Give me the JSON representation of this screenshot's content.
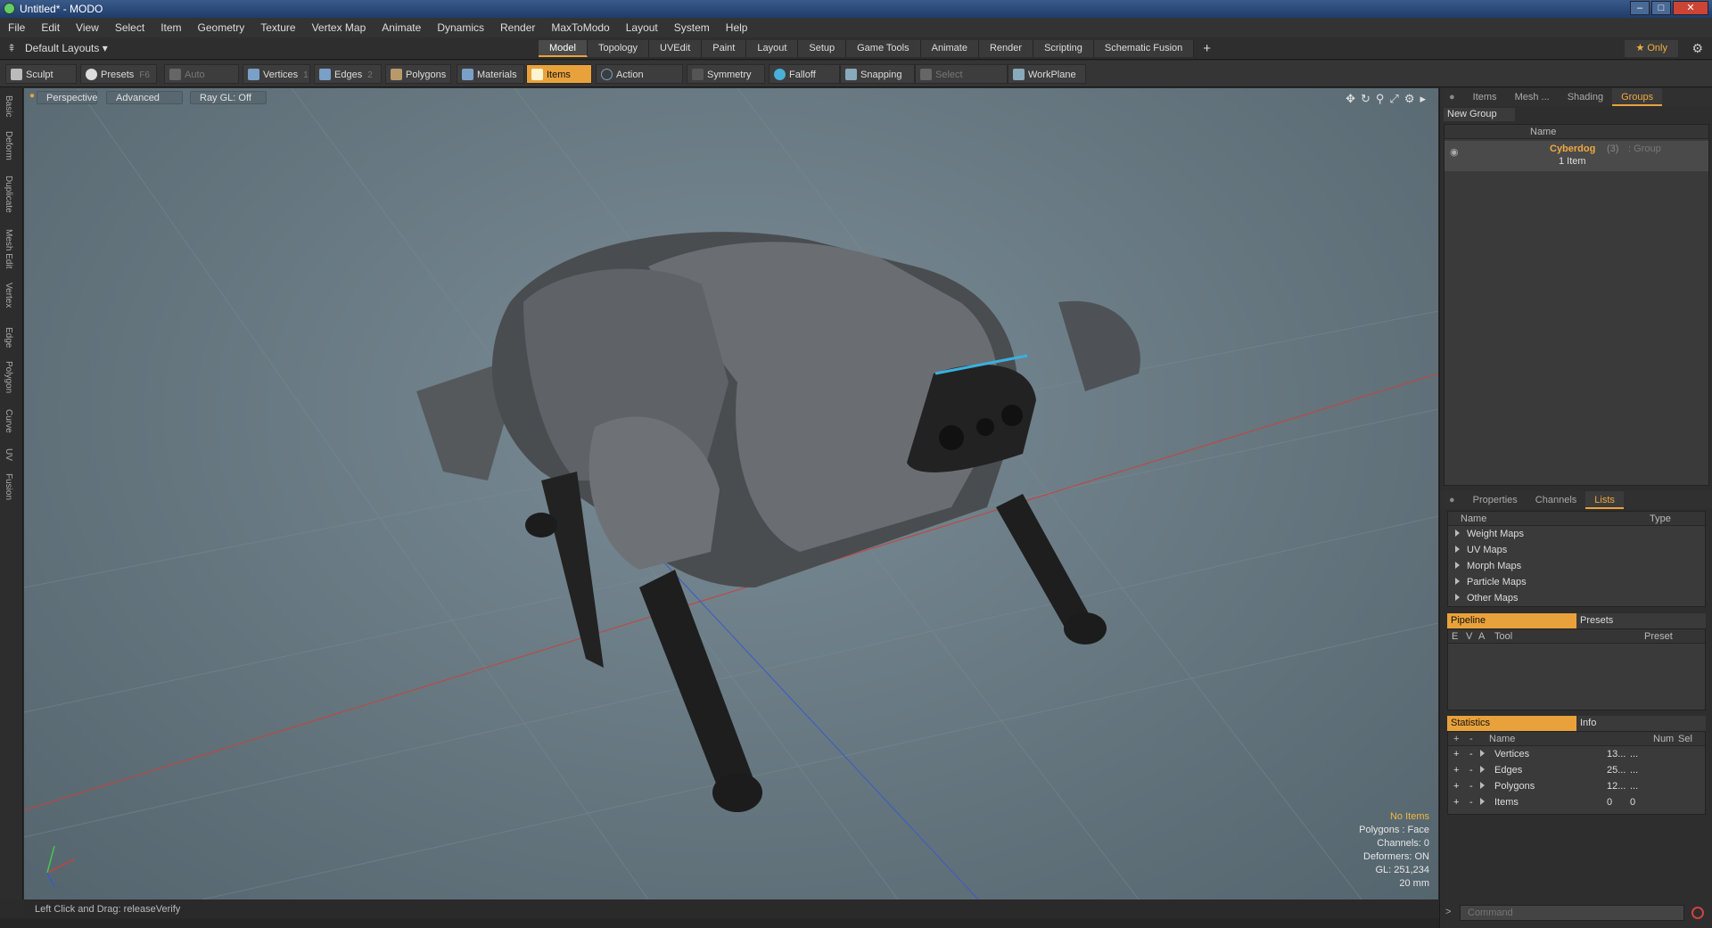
{
  "window": {
    "title": "Untitled* - MODO"
  },
  "menu": [
    "File",
    "Edit",
    "View",
    "Select",
    "Item",
    "Geometry",
    "Texture",
    "Vertex Map",
    "Animate",
    "Dynamics",
    "Render",
    "MaxToModo",
    "Layout",
    "System",
    "Help"
  ],
  "layout": {
    "menu_label": "Default Layouts ▾",
    "tabs": [
      "Model",
      "Topology",
      "UVEdit",
      "Paint",
      "Layout",
      "Setup",
      "Game Tools",
      "Animate",
      "Render",
      "Scripting",
      "Schematic Fusion"
    ],
    "active_tab": "Model",
    "add_tab": "+",
    "only_label": "★ Only"
  },
  "toolbar": {
    "sculpt": "Sculpt",
    "presets": "Presets",
    "presets_key": "F6",
    "auto_select": "Auto Select",
    "vertices": "Vertices",
    "vertices_key": "1",
    "edges": "Edges",
    "edges_key": "2",
    "polygons": "Polygons",
    "materials": "Materials",
    "items": "Items",
    "action_center": "Action Center",
    "symmetry": "Symmetry",
    "falloff": "Falloff",
    "snapping": "Snapping",
    "select_through": "Select Through",
    "workplane": "WorkPlane"
  },
  "left_strip": [
    "Basic",
    "Deform",
    "Duplicate",
    "Mesh Edit",
    "Vertex",
    "Edge",
    "Polygon",
    "Curve",
    "UV",
    "Fusion"
  ],
  "viewport": {
    "perspective": "Perspective",
    "advanced": "Advanced",
    "raygl": "Ray GL: Off",
    "stats": {
      "no_items": "No Items",
      "polygons": "Polygons : Face",
      "channels": "Channels: 0",
      "deformers": "Deformers: ON",
      "gl": "GL: 251,234",
      "scale": "20 mm"
    }
  },
  "status": {
    "text": "Left Click and Drag:  releaseVerify"
  },
  "right_panel": {
    "top_tabs": [
      "Items",
      "Mesh ...",
      "Shading",
      "Groups"
    ],
    "active_top_tab": "Groups",
    "new_group": "New Group",
    "groups_header": "Name",
    "group": {
      "name": "Cyberdog",
      "count": "(3)",
      "type": ": Group",
      "items": "1 Item"
    },
    "mid_tabs": [
      "Properties",
      "Channels",
      "Lists"
    ],
    "active_mid_tab": "Lists",
    "lists_header_name": "Name",
    "lists_header_type": "Type",
    "lists": [
      "Weight Maps",
      "UV Maps",
      "Morph Maps",
      "Particle Maps",
      "Other Maps"
    ],
    "pipeline_tab": "Pipeline",
    "presets_tab": "Presets",
    "pipeline_cols": {
      "e": "E",
      "v": "V",
      "a": "A",
      "tool": "Tool",
      "preset": "Preset"
    },
    "stats_tab": "Statistics",
    "info_tab": "Info",
    "stats_cols": {
      "plus": "+",
      "minus": "-",
      "name": "Name",
      "num": "Num",
      "sel": "Sel"
    },
    "stats_rows": [
      {
        "name": "Vertices",
        "num": "13...",
        "sel": "..."
      },
      {
        "name": "Edges",
        "num": "25...",
        "sel": "..."
      },
      {
        "name": "Polygons",
        "num": "12...",
        "sel": "..."
      },
      {
        "name": "Items",
        "num": "0",
        "sel": "0"
      }
    ],
    "command_placeholder": "Command"
  },
  "colors": {
    "accent": "#e9a23b",
    "viewport": "#6a7b85",
    "axis_x": "#c8423a",
    "axis_z": "#3a5ac8"
  }
}
